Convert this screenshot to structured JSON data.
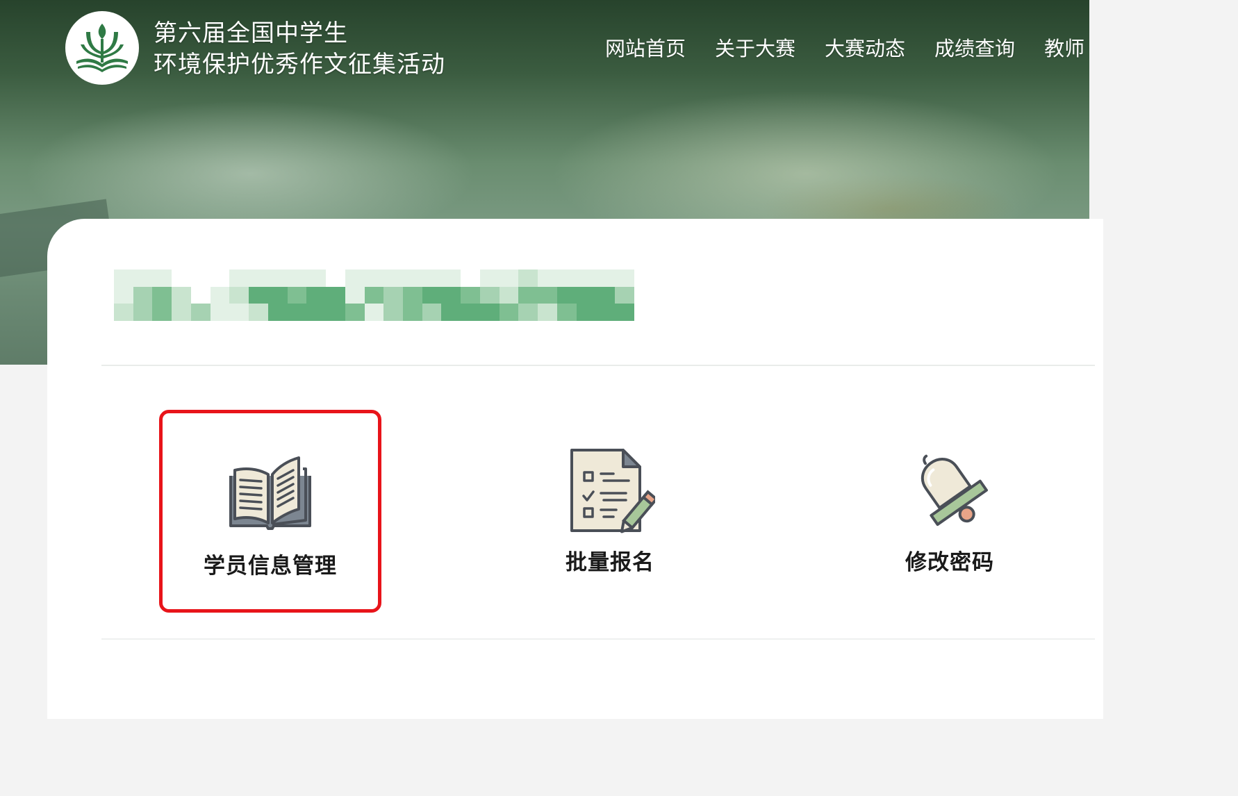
{
  "header": {
    "title_line1": "第六届全国中学生",
    "title_line2": "环境保护优秀作文征集活动"
  },
  "nav": {
    "items": [
      "网站首页",
      "关于大赛",
      "大赛动态",
      "成绩查询",
      "教师"
    ]
  },
  "tiles": [
    {
      "label": "学员信息管理",
      "icon": "open-book-icon",
      "selected": true
    },
    {
      "label": "批量报名",
      "icon": "checklist-icon",
      "selected": false
    },
    {
      "label": "修改密码",
      "icon": "bell-icon",
      "selected": false
    }
  ],
  "colors": {
    "accent_green": "#2f7a45",
    "selection_red": "#e8141a",
    "icon_cream": "#efe9d8",
    "icon_sage": "#a8c79a"
  }
}
